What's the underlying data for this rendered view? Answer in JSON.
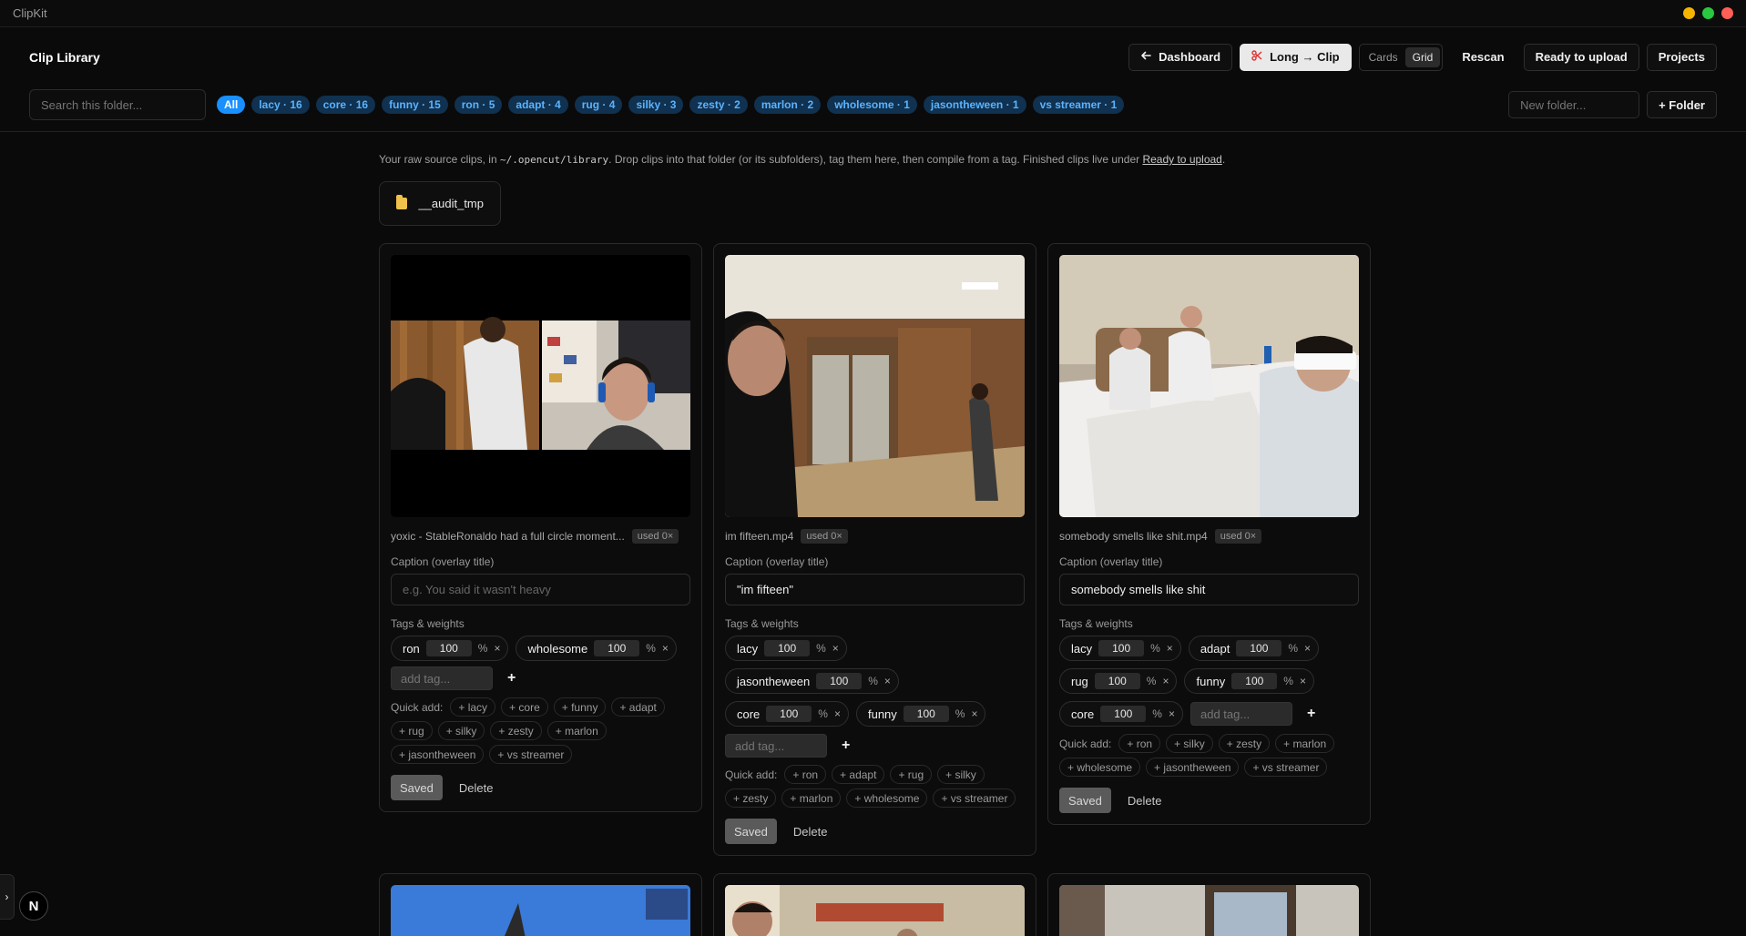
{
  "app": {
    "title": "ClipKit",
    "traffic_colors": [
      "#f5b400",
      "#28c840",
      "#ff5f57"
    ]
  },
  "header": {
    "title": "Clip Library",
    "dashboard_label": "Dashboard",
    "long_clip_label": "Long → Clip",
    "view_cards": "Cards",
    "view_grid": "Grid",
    "rescan_label": "Rescan",
    "ready_label": "Ready to upload",
    "projects_label": "Projects",
    "search_placeholder": "Search this folder...",
    "new_folder_placeholder": "New folder...",
    "add_folder_label": "+ Folder",
    "chips": [
      "All",
      "lacy · 16",
      "core · 16",
      "funny · 15",
      "ron · 5",
      "adapt · 4",
      "rug · 4",
      "silky · 3",
      "zesty · 2",
      "marlon · 2",
      "wholesome · 1",
      "jasontheween · 1",
      "vs streamer · 1"
    ],
    "accent": "#1890ff"
  },
  "intro": {
    "pre": "Your raw source clips, in ",
    "path": "~/.opencut/library",
    "mid": ". Drop clips into that folder (or its subfolders), tag them here, then compile from a tag. Finished clips live under ",
    "link": "Ready to upload",
    "post": "."
  },
  "folder": {
    "name": "__audit_tmp"
  },
  "cards": [
    {
      "filename": "yoxic - StableRonaldo had a full circle moment...",
      "used": "used 0×",
      "caption_label": "Caption (overlay title)",
      "caption_placeholder": "e.g. You said it wasn't heavy",
      "caption": "",
      "tags_label": "Tags & weights",
      "tags": [
        {
          "name": "ron",
          "weight": "100"
        },
        {
          "name": "wholesome",
          "weight": "100"
        }
      ],
      "add_tag_placeholder": "add tag...",
      "quick_label": "Quick add:",
      "quick": [
        "+ lacy",
        "+ core",
        "+ funny",
        "+ adapt",
        "+ rug",
        "+ silky",
        "+ zesty",
        "+ marlon",
        "+ jasontheween",
        "+ vs streamer"
      ],
      "saved": "Saved",
      "delete": "Delete"
    },
    {
      "filename": "im fifteen.mp4",
      "used": "used 0×",
      "caption_label": "Caption (overlay title)",
      "caption_placeholder": "",
      "caption": "\"im fifteen\"",
      "tags_label": "Tags & weights",
      "tags": [
        {
          "name": "lacy",
          "weight": "100"
        },
        {
          "name": "jasontheween",
          "weight": "100"
        },
        {
          "name": "core",
          "weight": "100"
        },
        {
          "name": "funny",
          "weight": "100"
        }
      ],
      "add_tag_placeholder": "add tag...",
      "quick_label": "Quick add:",
      "quick": [
        "+ ron",
        "+ adapt",
        "+ rug",
        "+ silky",
        "+ zesty",
        "+ marlon",
        "+ wholesome",
        "+ vs streamer"
      ],
      "saved": "Saved",
      "delete": "Delete"
    },
    {
      "filename": "somebody smells like shit.mp4",
      "used": "used 0×",
      "caption_label": "Caption (overlay title)",
      "caption_placeholder": "",
      "caption": "somebody smells like shit",
      "tags_label": "Tags & weights",
      "tags": [
        {
          "name": "lacy",
          "weight": "100"
        },
        {
          "name": "adapt",
          "weight": "100"
        },
        {
          "name": "rug",
          "weight": "100"
        },
        {
          "name": "funny",
          "weight": "100"
        },
        {
          "name": "core",
          "weight": "100"
        }
      ],
      "add_tag_placeholder": "add tag...",
      "quick_label": "Quick add:",
      "quick": [
        "+ ron",
        "+ silky",
        "+ zesty",
        "+ marlon",
        "+ wholesome",
        "+ jasontheween",
        "+ vs streamer"
      ],
      "saved": "Saved",
      "delete": "Delete"
    }
  ],
  "badge": {
    "letter": "N"
  },
  "side_toggle": {
    "glyph": "›"
  }
}
